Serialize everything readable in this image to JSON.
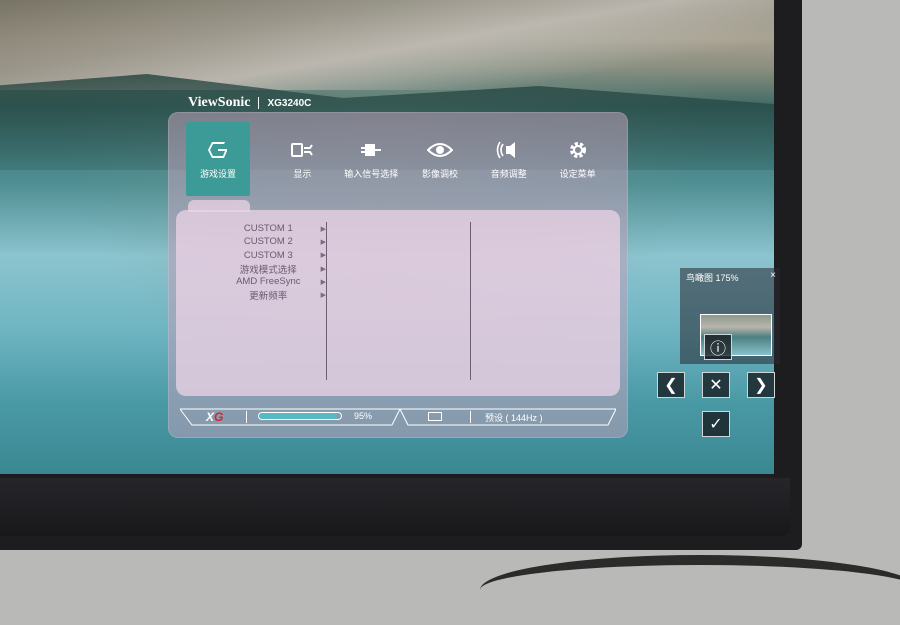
{
  "brand": {
    "name": "ViewSonic",
    "model": "XG3240C"
  },
  "osd": {
    "tabs": [
      {
        "label": "游戏设置",
        "icon": "game-g-icon",
        "active": true
      },
      {
        "label": "显示",
        "icon": "display-tools-icon",
        "active": false
      },
      {
        "label": "输入信号选择",
        "icon": "input-plug-icon",
        "active": false
      },
      {
        "label": "影像调校",
        "icon": "eye-icon",
        "active": false
      },
      {
        "label": "音频调整",
        "icon": "speaker-icon",
        "active": false
      },
      {
        "label": "设定菜单",
        "icon": "gear-icon",
        "active": false
      }
    ],
    "menu": [
      {
        "label": "CUSTOM 1",
        "arrow": "▶"
      },
      {
        "label": "CUSTOM 2",
        "arrow": "▶"
      },
      {
        "label": "CUSTOM 3",
        "arrow": "▶"
      },
      {
        "label": "游戏模式选择",
        "arrow": "▶"
      },
      {
        "label": "AMD FreeSync",
        "arrow": "▶"
      },
      {
        "label": "更新频率",
        "arrow": "▶"
      }
    ],
    "status": {
      "logo_x": "X",
      "logo_g": "G",
      "progress": 0.95,
      "percent_text": "95%",
      "preset_text": "预设 ( 144Hz )"
    }
  },
  "mini_panel": {
    "caption": "鸟瞰图 175%",
    "close_label": "×"
  },
  "nav": {
    "info_label": "ⓘ",
    "left_label": "❮",
    "close_label": "✕",
    "right_label": "❯",
    "confirm_label": "✓"
  },
  "colors": {
    "accent": "#3c9b96",
    "progress_fill": "#57b9c4",
    "logo_red": "#d8242a"
  }
}
